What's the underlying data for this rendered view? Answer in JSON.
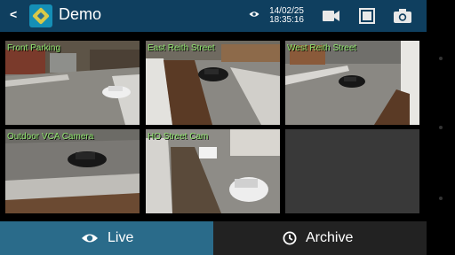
{
  "header": {
    "back_glyph": "<",
    "logo_icon": "app-logo-icon",
    "title": "Demo",
    "date": "14/02/25",
    "time": "18:35:16",
    "actions": [
      "video-camera-icon",
      "fullscreen-icon",
      "snapshot-camera-icon"
    ]
  },
  "cameras": [
    {
      "label": "Front Parking"
    },
    {
      "label": "East Reith Street"
    },
    {
      "label": "West Reith Street"
    },
    {
      "label": "Outdoor VCA Camera"
    },
    {
      "label": "HO Street Cam"
    },
    {
      "label": ""
    }
  ],
  "tabs": {
    "live": "Live",
    "archive": "Archive",
    "active": "Live"
  },
  "colors": {
    "header_bg": "#0f3f5f",
    "label_green": "#8fe36d",
    "active_tab": "#2a6b8a",
    "inactive_tab": "#222222"
  }
}
